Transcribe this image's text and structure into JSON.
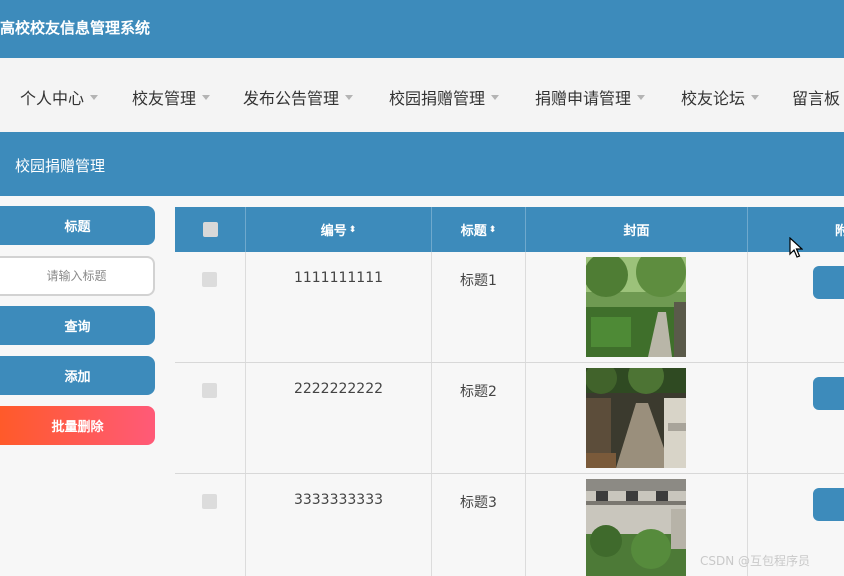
{
  "app": {
    "title": "高校校友信息管理系统"
  },
  "nav": {
    "items": [
      {
        "label": "个人中心"
      },
      {
        "label": "校友管理"
      },
      {
        "label": "发布公告管理"
      },
      {
        "label": "校园捐赠管理"
      },
      {
        "label": "捐赠申请管理"
      },
      {
        "label": "校友论坛"
      },
      {
        "label": "留言板"
      }
    ]
  },
  "section": {
    "title": "校园捐赠管理"
  },
  "search": {
    "field_label": "标题",
    "placeholder": "请输入标题",
    "query_label": "查询",
    "add_label": "添加",
    "batch_delete_label": "批量删除"
  },
  "table": {
    "headers": {
      "number": "编号",
      "title": "标题",
      "cover": "封面",
      "extra": "附"
    },
    "sort_glyph": "⬍",
    "rows": [
      {
        "number": "1111111111",
        "title": "标题1",
        "cover": "park-path-photo"
      },
      {
        "number": "2222222222",
        "title": "标题2",
        "cover": "covered-walkway-photo"
      },
      {
        "number": "3333333333",
        "title": "标题3",
        "cover": "campus-building-photo"
      }
    ]
  },
  "watermark": "CSDN @互包程序员",
  "colors": {
    "primary": "#3d8bbb",
    "nav_bg": "#f4f4f4",
    "danger_start": "#ff5a2a",
    "danger_end": "#ff5a78"
  }
}
